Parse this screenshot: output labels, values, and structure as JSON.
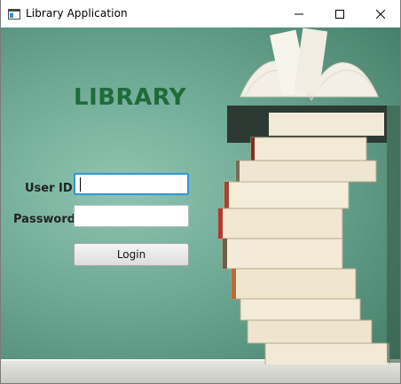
{
  "window": {
    "title": "Library Application",
    "controls": [
      "minimize",
      "maximize",
      "close"
    ]
  },
  "main": {
    "heading": "LIBRARY",
    "heading_color": "#1f6b3a",
    "user_id": {
      "label": "User ID",
      "value": "",
      "focused": true
    },
    "password": {
      "label": "Password",
      "value": ""
    },
    "login_label": "Login"
  },
  "icons": [
    "app-window-icon",
    "minimize-icon",
    "maximize-icon",
    "close-icon"
  ],
  "background": {
    "theme": "green chalkboard with stacked books",
    "accent": "#2f95d6"
  }
}
